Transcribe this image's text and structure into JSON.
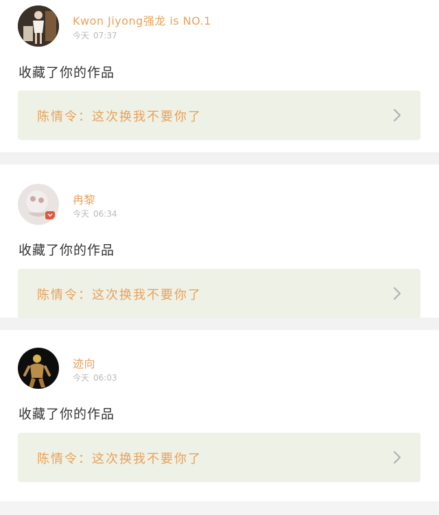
{
  "notifications": [
    {
      "username": "Kwon Jiyong强龙 is NO.1",
      "day": "今天",
      "time": "07:37",
      "action": "收藏了你的作品",
      "work": {
        "fandom": "陈情令",
        "separator": "：",
        "title": "这次换我不要你了"
      },
      "avatar_icon": "user-photo-woman"
    },
    {
      "username": "冉黎",
      "day": "今天",
      "time": "06:34",
      "action": "收藏了你的作品",
      "work": {
        "fandom": "陈情令",
        "separator": "：",
        "title": "这次换我不要你了"
      },
      "avatar_icon": "user-photo-cat"
    },
    {
      "username": "迹向",
      "day": "今天",
      "time": "06:03",
      "action": "收藏了你的作品",
      "work": {
        "fandom": "陈情令",
        "separator": "：",
        "title": "这次换我不要你了"
      },
      "avatar_icon": "user-photo-figure"
    }
  ],
  "colors": {
    "accent": "#e8a15a",
    "work_bg": "#eef1e6",
    "time": "#b9b9b9",
    "text": "#333333"
  }
}
